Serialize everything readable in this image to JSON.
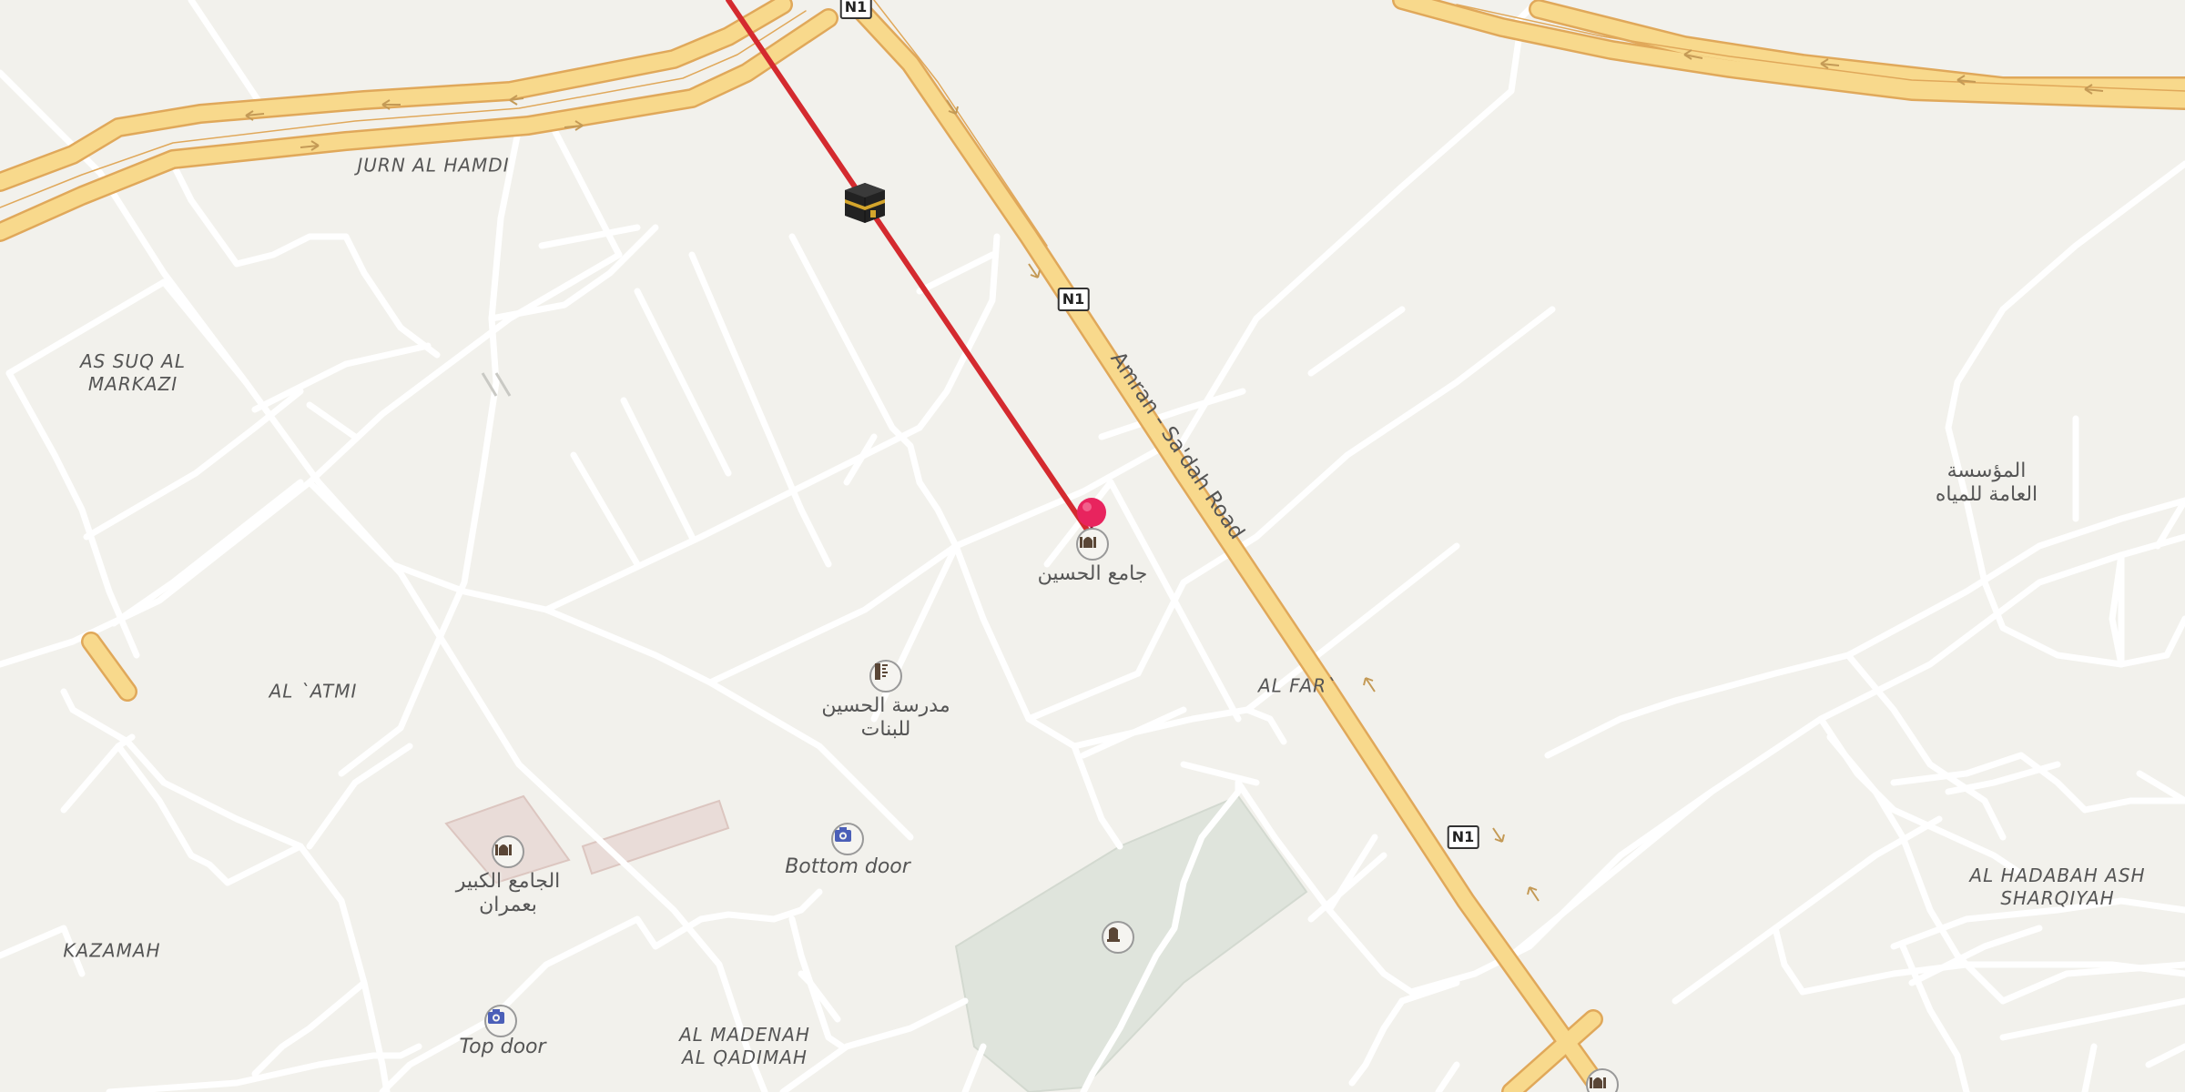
{
  "map": {
    "area_labels": [
      {
        "name": "jurn-al-hamdi",
        "lines": [
          "JURN AL HAMDI"
        ]
      },
      {
        "name": "as-suq-al-markazi",
        "lines": [
          "AS SUQ AL",
          "MARKAZI"
        ]
      },
      {
        "name": "al-atmi",
        "lines": [
          "AL `ATMI"
        ]
      },
      {
        "name": "kazamah",
        "lines": [
          "KAZAMAH"
        ]
      },
      {
        "name": "al-madenah-al-qadimah",
        "lines": [
          "AL MADENAH",
          "AL QADIMAH"
        ]
      },
      {
        "name": "al-far",
        "lines": [
          "AL FAR`"
        ]
      },
      {
        "name": "al-hadabah-ash-sharqiyah",
        "lines": [
          "AL HADABAH ASH",
          "SHARQIYAH"
        ]
      }
    ],
    "road_name": "Amran - Sa'dah Road",
    "shield_label": "N1",
    "pois": {
      "mosque_selected": {
        "lines": [
          "جامع الحسين"
        ],
        "icon": "mosque-icon"
      },
      "school": {
        "lines": [
          "مدرسة الحسين",
          "للبنات"
        ],
        "icon": "school-icon"
      },
      "great_mosque": {
        "lines": [
          "الجامع الكبير",
          "بعمران"
        ],
        "icon": "mosque-icon"
      },
      "water_org": {
        "lines": [
          "المؤسسة",
          "العامة للمياه"
        ]
      },
      "bottom_door": {
        "lines": [
          "Bottom door"
        ],
        "icon": "camera-icon"
      },
      "top_door": {
        "lines": [
          "Top door"
        ],
        "icon": "camera-icon"
      },
      "cemetery": {
        "icon": "tombstone-icon"
      }
    },
    "markers": {
      "kaaba": {
        "icon": "kaaba-icon"
      },
      "selected_pin": {
        "icon": "location-pin-icon",
        "color": "#e8245e"
      }
    },
    "qibla_line_color": "#d42a2f",
    "colors": {
      "background": "#f2f1ec",
      "minor_road": "#ffffff",
      "major_road_fill": "#f8d98c",
      "major_road_casing": "#e0a85a",
      "park": "#dfe4dc"
    }
  }
}
